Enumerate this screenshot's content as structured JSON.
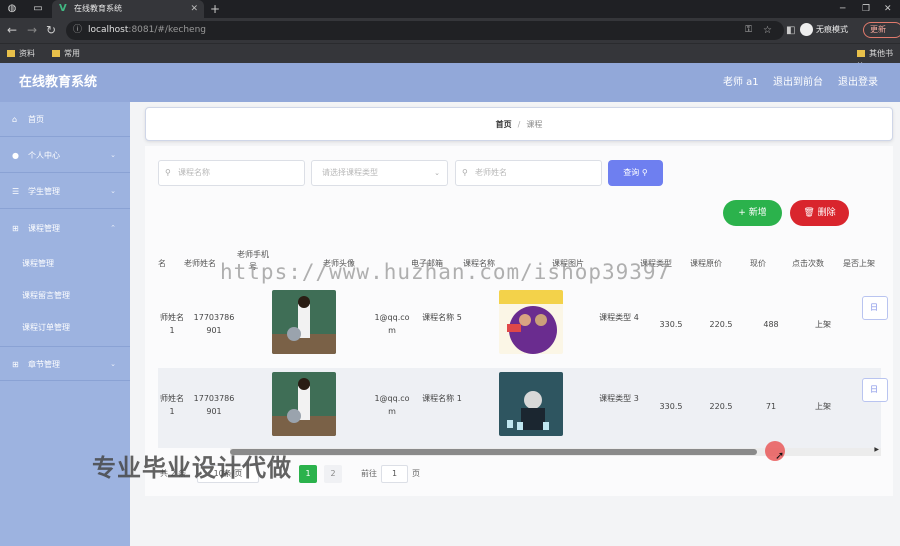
{
  "browser": {
    "tab_title": "在线教育系统",
    "url_host": "localhost",
    "url_path": ":8081/#/kecheng",
    "incognito_label": "无痕模式",
    "update_label": "更新",
    "bookmarks": [
      "资料",
      "常用"
    ],
    "other_bookmarks": "其他书签"
  },
  "app": {
    "title": "在线教育系统",
    "user": "老师 a1",
    "back_to_backend": "退出到前台",
    "logout": "退出登录"
  },
  "sidebar": {
    "items": [
      {
        "label": "首页",
        "icon": "home-icon"
      },
      {
        "label": "个人中心",
        "icon": "user-icon"
      },
      {
        "label": "学生管理",
        "icon": "list-icon"
      },
      {
        "label": "课程管理",
        "icon": "grid-icon"
      },
      {
        "label": "章节管理",
        "icon": "grid-icon"
      }
    ],
    "sub_items": [
      "课程管理",
      "课程留言管理",
      "课程订单管理"
    ]
  },
  "breadcrumb": {
    "home": "首页",
    "sep": "/",
    "current": "课程"
  },
  "search": {
    "course_name_placeholder": "课程名称",
    "course_type_placeholder": "请选择课程类型",
    "teacher_name_placeholder": "老师姓名",
    "query_label": "查询"
  },
  "actions": {
    "add_label": "新增",
    "delete_label": "删除"
  },
  "table": {
    "headers": {
      "h0": "名",
      "h1": "老师姓名",
      "h2": "老师手机号",
      "h3": "老师头像",
      "h4": "电子邮箱",
      "h5": "课程名称",
      "h6": "课程图片",
      "h7": "课程类型",
      "h8": "课程原价",
      "h9": "现价",
      "h10": "点击次数",
      "h11": "是否上架"
    },
    "rows": [
      {
        "name_partial": "师姓名 1",
        "phone": "17703786901",
        "email": "1@qq.com",
        "course_name": "课程名称 5",
        "course_type": "课程类型 4",
        "orig_price": "330.5",
        "price": "220.5",
        "clicks": "488",
        "status": "上架",
        "op": "日"
      },
      {
        "name_partial": "师姓名 1",
        "phone": "17703786901",
        "email": "1@qq.com",
        "course_name": "课程名称 1",
        "course_type": "课程类型 3",
        "orig_price": "330.5",
        "price": "220.5",
        "clicks": "71",
        "status": "上架",
        "op": "日"
      }
    ]
  },
  "pagination": {
    "total": "共 2 条",
    "page_size": "10条/页",
    "current_page": "1",
    "next_page": "2",
    "goto_label": "前往",
    "goto_value": "1",
    "page_suffix": "页"
  },
  "watermarks": {
    "url": "https://www.huzhan.com/ishop39397",
    "caption": "专业毕业设计代做"
  }
}
